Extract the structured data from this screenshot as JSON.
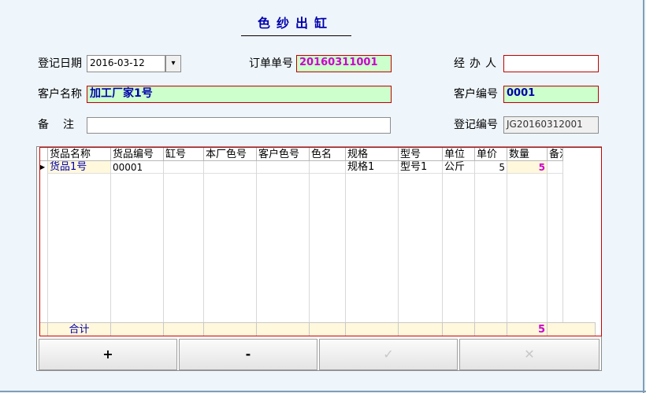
{
  "form": {
    "title": "色纱出缸",
    "reg_date_label": "登记日期",
    "reg_date_value": "2016-03-12",
    "order_no_label": "订单单号",
    "order_no_value": "20160311001",
    "handler_label": "经办人",
    "handler_value": "",
    "customer_name_label": "客户名称",
    "customer_name_value": "加工厂家1号",
    "customer_no_label": "客户编号",
    "customer_no_value": "0001",
    "remark_label": "备注",
    "remark_value": "",
    "reg_no_label": "登记编号",
    "reg_no_value": "JG20160312001"
  },
  "grid": {
    "columns": [
      "货品名称",
      "货品编号",
      "缸号",
      "本厂色号",
      "客户色号",
      "色名",
      "规格",
      "型号",
      "单位",
      "单价",
      "数量",
      "备注"
    ],
    "rows": [
      [
        "货品1号",
        "00001",
        "",
        "",
        "",
        "",
        "规格1",
        "型号1",
        "公斤",
        "5",
        "5",
        ""
      ]
    ],
    "total_label": "合计",
    "total_qty": "5"
  },
  "buttons": {
    "add": "+",
    "remove": "-",
    "confirm": "✓",
    "cancel": "✕"
  },
  "colors": {
    "title": "#0000aa",
    "green_field": "#ccffcc",
    "red_border": "#c00000",
    "magenta_text": "#cc00cc",
    "blue_text": "#0000aa"
  }
}
